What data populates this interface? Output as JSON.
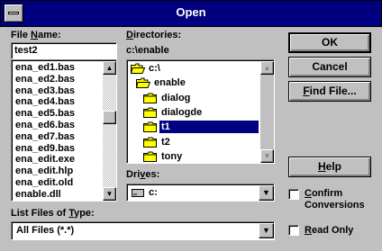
{
  "window": {
    "title": "Open"
  },
  "file_name": {
    "label_pre": "File ",
    "label_key": "N",
    "label_post": "ame:",
    "value": "test2",
    "files": [
      "ena_ed1.bas",
      "ena_ed2.bas",
      "ena_ed3.bas",
      "ena_ed4.bas",
      "ena_ed5.bas",
      "ena_ed6.bas",
      "ena_ed7.bas",
      "ena_ed9.bas",
      "ena_edit.exe",
      "ena_edit.hlp",
      "ena_edit.old",
      "enable.dll"
    ]
  },
  "directories": {
    "label_key": "D",
    "label_post": "irectories:",
    "current_path": "c:\\enable",
    "items": [
      {
        "name": "c:\\",
        "type": "open"
      },
      {
        "name": "enable",
        "type": "open"
      },
      {
        "name": "dialog",
        "type": "closed"
      },
      {
        "name": "dialogde",
        "type": "closed"
      },
      {
        "name": "t1",
        "type": "closed",
        "selected": true
      },
      {
        "name": "t2",
        "type": "closed"
      },
      {
        "name": "tony",
        "type": "closed"
      }
    ]
  },
  "drives": {
    "label_pre": "Dri",
    "label_key": "v",
    "label_post": "es:",
    "value": "c:"
  },
  "list_type": {
    "label_pre": "List Files of ",
    "label_key": "T",
    "label_post": "ype:",
    "value": "All Files (*.*)"
  },
  "buttons": {
    "ok": "OK",
    "cancel": "Cancel",
    "find_key": "F",
    "find_rest": "ind File...",
    "help_key": "H",
    "help_rest": "elp"
  },
  "checkboxes": {
    "confirm_key": "C",
    "confirm_line1_rest": "onfirm",
    "confirm_line2": "Conversions",
    "readonly_key": "R",
    "readonly_rest": "ead Only",
    "confirm_checked": false,
    "readonly_checked": false
  },
  "colors": {
    "title_bar": "#000080",
    "selection": "#000080",
    "face": "#c0c0c0",
    "folder": "#ffff00"
  }
}
